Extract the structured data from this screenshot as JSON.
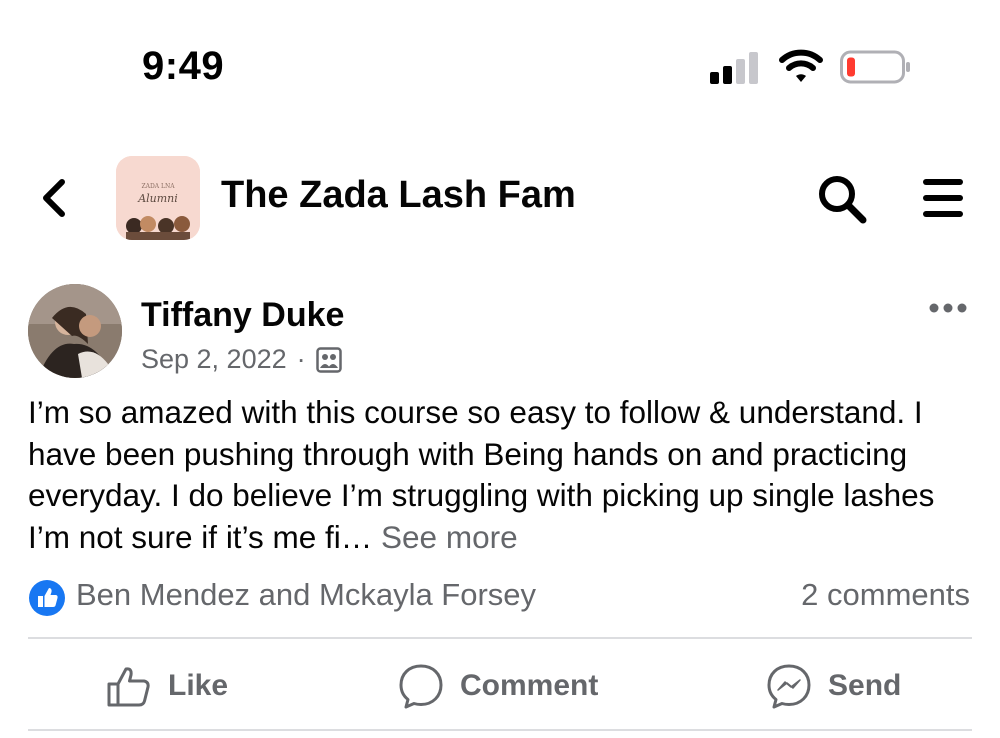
{
  "status_bar": {
    "time": "9:49",
    "battery_level": 0.1,
    "battery_color": "#ff3b30"
  },
  "header": {
    "title": "The Zada Lash Fam",
    "group_thumbnail_text_top": "ZADA LNA",
    "group_thumbnail_text_script": "Alumni",
    "icons": [
      "back-arrow-icon",
      "search-icon",
      "hamburger-menu-icon"
    ]
  },
  "post": {
    "author": "Tiffany Duke",
    "date": "Sep 2, 2022",
    "separator": "·",
    "text": "I’m so amazed with this course so easy to follow & understand. I have been pushing through with Being hands on and practicing everyday. I do believe I’m struggling with picking up single lashes I’m not sure if it’s me fi…",
    "see_more": "See more",
    "reactors": "Ben Mendez and Mckayla Forsey",
    "comment_count": "2 comments"
  },
  "actions": {
    "like": "Like",
    "comment": "Comment",
    "send": "Send"
  },
  "colors": {
    "facebook_blue": "#1877f2",
    "secondary_text": "#65676b",
    "primary_text": "#050505",
    "divider": "#dcdde0"
  }
}
